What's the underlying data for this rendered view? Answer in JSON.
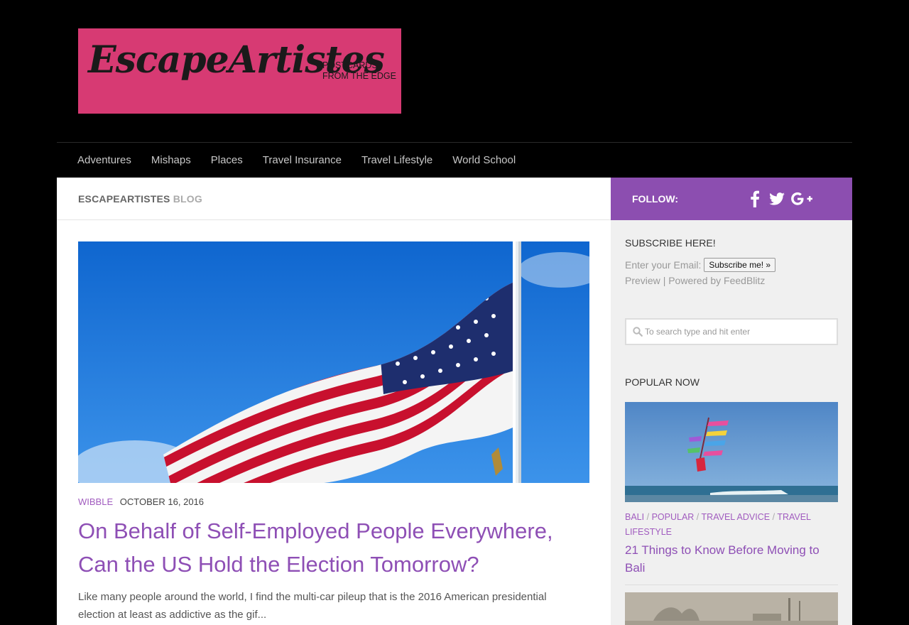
{
  "logo": {
    "name": "EscapeArtistes",
    "tagline_line1": "POSTCARDS",
    "tagline_line2": "FROM THE EDGE"
  },
  "nav": {
    "items": [
      "Adventures",
      "Mishaps",
      "Places",
      "Travel Insurance",
      "Travel Lifestyle",
      "World School"
    ]
  },
  "page_header": {
    "title_bold": "ESCAPEARTISTES",
    "title_light": "BLOG"
  },
  "post": {
    "category": "WIBBLE",
    "date": "OCTOBER 16, 2016",
    "title": "On Behalf of Self-Employed People Everywhere, Can the US Hold the Election Tomorrow?",
    "excerpt": "Like many people around the world, I find the multi-car pileup that is the 2016 American presidential election at least as addictive as the gif..."
  },
  "sidebar": {
    "follow_label": "FOLLOW:",
    "social_icons": [
      "facebook-icon",
      "twitter-icon",
      "google-plus-icon"
    ],
    "subscribe": {
      "heading": "SUBSCRIBE HERE!",
      "email_label": "Enter your Email:",
      "button": "Subscribe me! »",
      "preview_link": "Preview",
      "separator": "|",
      "powered_by": "Powered by FeedBlitz"
    },
    "search": {
      "placeholder": "To search type and hit enter"
    },
    "popular": {
      "heading": "POPULAR NOW",
      "categories": [
        "BALI",
        "POPULAR",
        "TRAVEL ADVICE",
        "TRAVEL LIFESTYLE"
      ],
      "cat_separator": "/",
      "title": "21 Things to Know Before Moving to Bali"
    }
  },
  "colors": {
    "accent": "#8c4eb0",
    "link": "#a15cbf",
    "logo_bg": "#d73a73"
  }
}
